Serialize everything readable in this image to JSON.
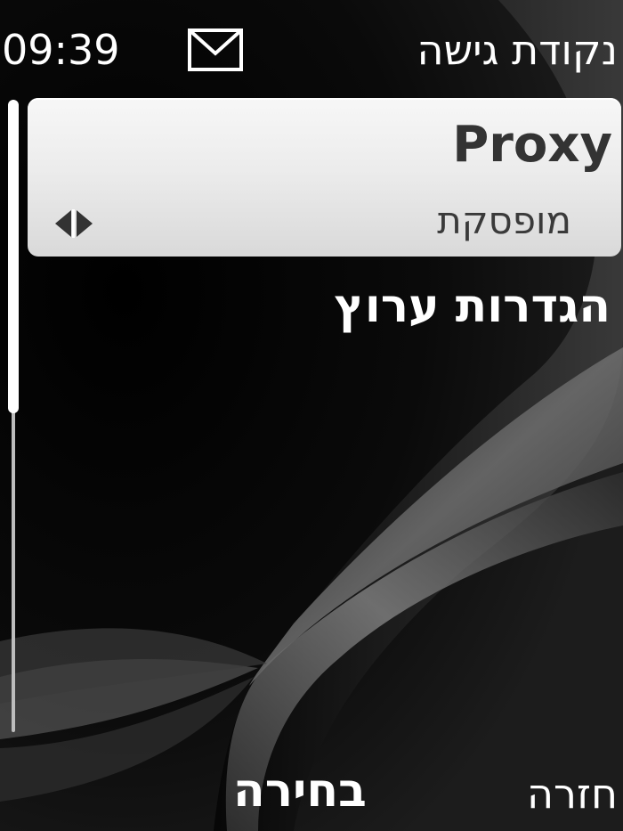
{
  "status_bar": {
    "time": "09:39",
    "title": "נקודת גישה",
    "mail_icon": "envelope-icon"
  },
  "list": {
    "items": [
      {
        "title": "Proxy",
        "value": "מופסקת",
        "selected": true,
        "arrows_icon": "left-right-arrows-icon"
      },
      {
        "title": "הגדרות ערוץ",
        "selected": false
      }
    ]
  },
  "scrollbar": {
    "position_fraction": 0.0,
    "visible_fraction": 0.5
  },
  "softkeys": {
    "select": "בחירה",
    "back": "חזרה"
  },
  "colors": {
    "background": "#000000",
    "highlight": "#ececec",
    "highlight_text": "#333333",
    "text": "#ffffff"
  }
}
